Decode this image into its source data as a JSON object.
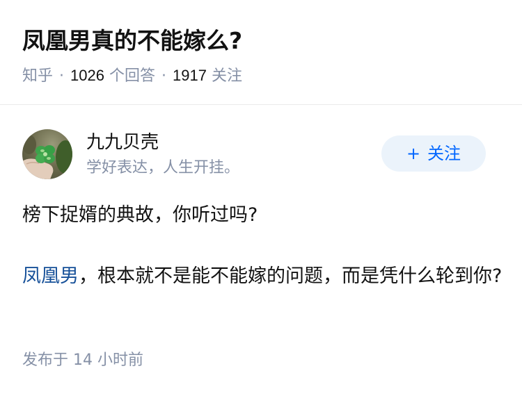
{
  "question": {
    "title": "凤凰男真的不能嫁么?",
    "source": "知乎",
    "answer_count": "1026",
    "answer_label": "个回答",
    "follower_count": "1917",
    "follower_label": "关注"
  },
  "answer": {
    "author_name": "九九贝壳",
    "author_bio": "学好表达，人生开挂。",
    "follow_button": {
      "icon": "plus-icon",
      "label": "关注"
    },
    "paragraph_1": "榜下捉婿的典故，你听过吗?",
    "paragraph_2_link": "凤凰男",
    "paragraph_2_rest": "，根本就不是能不能嫁的问题，而是凭什么轮到你?",
    "publish_label": "发布于",
    "publish_time": "14 小时前"
  },
  "colors": {
    "link": "#175199",
    "accent": "#0066ff",
    "meta": "#8590a6",
    "follow_bg": "#ebf3fb"
  }
}
